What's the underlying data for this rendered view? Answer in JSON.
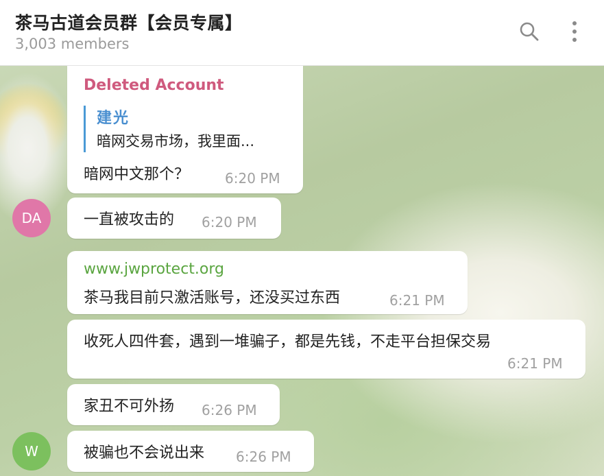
{
  "header": {
    "title": "茶马古道会员群【会员专属】",
    "members": "3,003 members",
    "search_icon": "search-icon",
    "more_icon": "more-vertical-icon"
  },
  "messages": [
    {
      "sender": "Deleted Account",
      "sender_color": "#cf5a7e",
      "reply": {
        "name": "建光",
        "text": "暗网交易市场，我里面..."
      },
      "text": "暗网中文那个？",
      "time": "6:20 PM"
    },
    {
      "text": "一直被攻击的",
      "time": "6:20 PM",
      "avatar": {
        "initials": "DA",
        "color": "#e077a8"
      }
    },
    {
      "link": "www.jwprotect.org",
      "link_color": "#5aa540",
      "text": "茶马我目前只激活账号，还没买过东西",
      "time": "6:21 PM"
    },
    {
      "text": "收死人四件套，遇到一堆骗子，都是先钱，不走平台担保交易",
      "time": "6:21 PM"
    },
    {
      "text": "家丑不可外扬",
      "time": "6:26 PM"
    },
    {
      "text": "被骗也不会说出来",
      "time": "6:26 PM",
      "avatar": {
        "initials": "W",
        "color": "#7cc05e"
      }
    }
  ]
}
